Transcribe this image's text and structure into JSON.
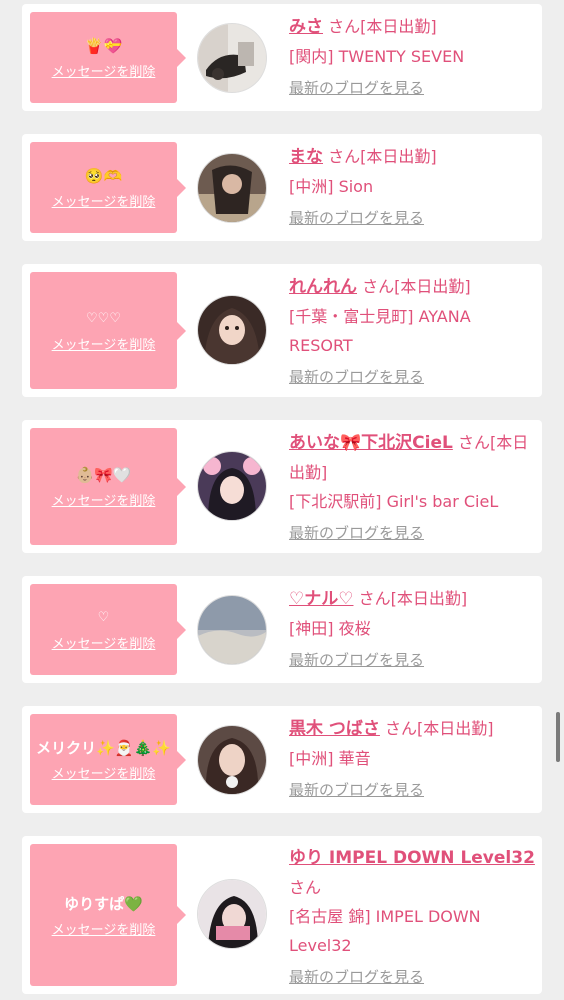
{
  "delete_label": "メッセージを削除",
  "blog_label": "最新のブログを見る",
  "san_label": "さん",
  "accent_color": "#e0507a",
  "bubble_color": "#fda4b3",
  "cards": [
    {
      "message": "🍟💝",
      "name": "みさ",
      "status": "[本日出勤]",
      "shop": "[関内] TWENTY SEVEN"
    },
    {
      "message": "🥺🫶",
      "name": "まな",
      "status": "[本日出勤]",
      "shop": "[中洲] Sion"
    },
    {
      "message": "♡♡♡",
      "name": "れんれん",
      "status": "[本日出勤]",
      "shop": "[千葉・富士見町] AYANA RESORT"
    },
    {
      "message": "👶🏼🎀🤍",
      "name": "あいな🎀下北沢CieL",
      "status": "[本日出勤]",
      "shop": "[下北沢駅前] Girl's bar CieL"
    },
    {
      "message": "♡",
      "name": "♡ナル♡",
      "status": "[本日出勤]",
      "shop": "[神田] 夜桜"
    },
    {
      "message": "メリクリ✨🎅🎄✨",
      "name": "黒木 つばさ",
      "status": "[本日出勤]",
      "shop": "[中洲] 華音"
    },
    {
      "message": "ゆりすぱ💚",
      "name": "ゆり IMPEL DOWN Level32",
      "status": "",
      "shop": "[名古屋 錦] IMPEL DOWN Level32"
    }
  ]
}
